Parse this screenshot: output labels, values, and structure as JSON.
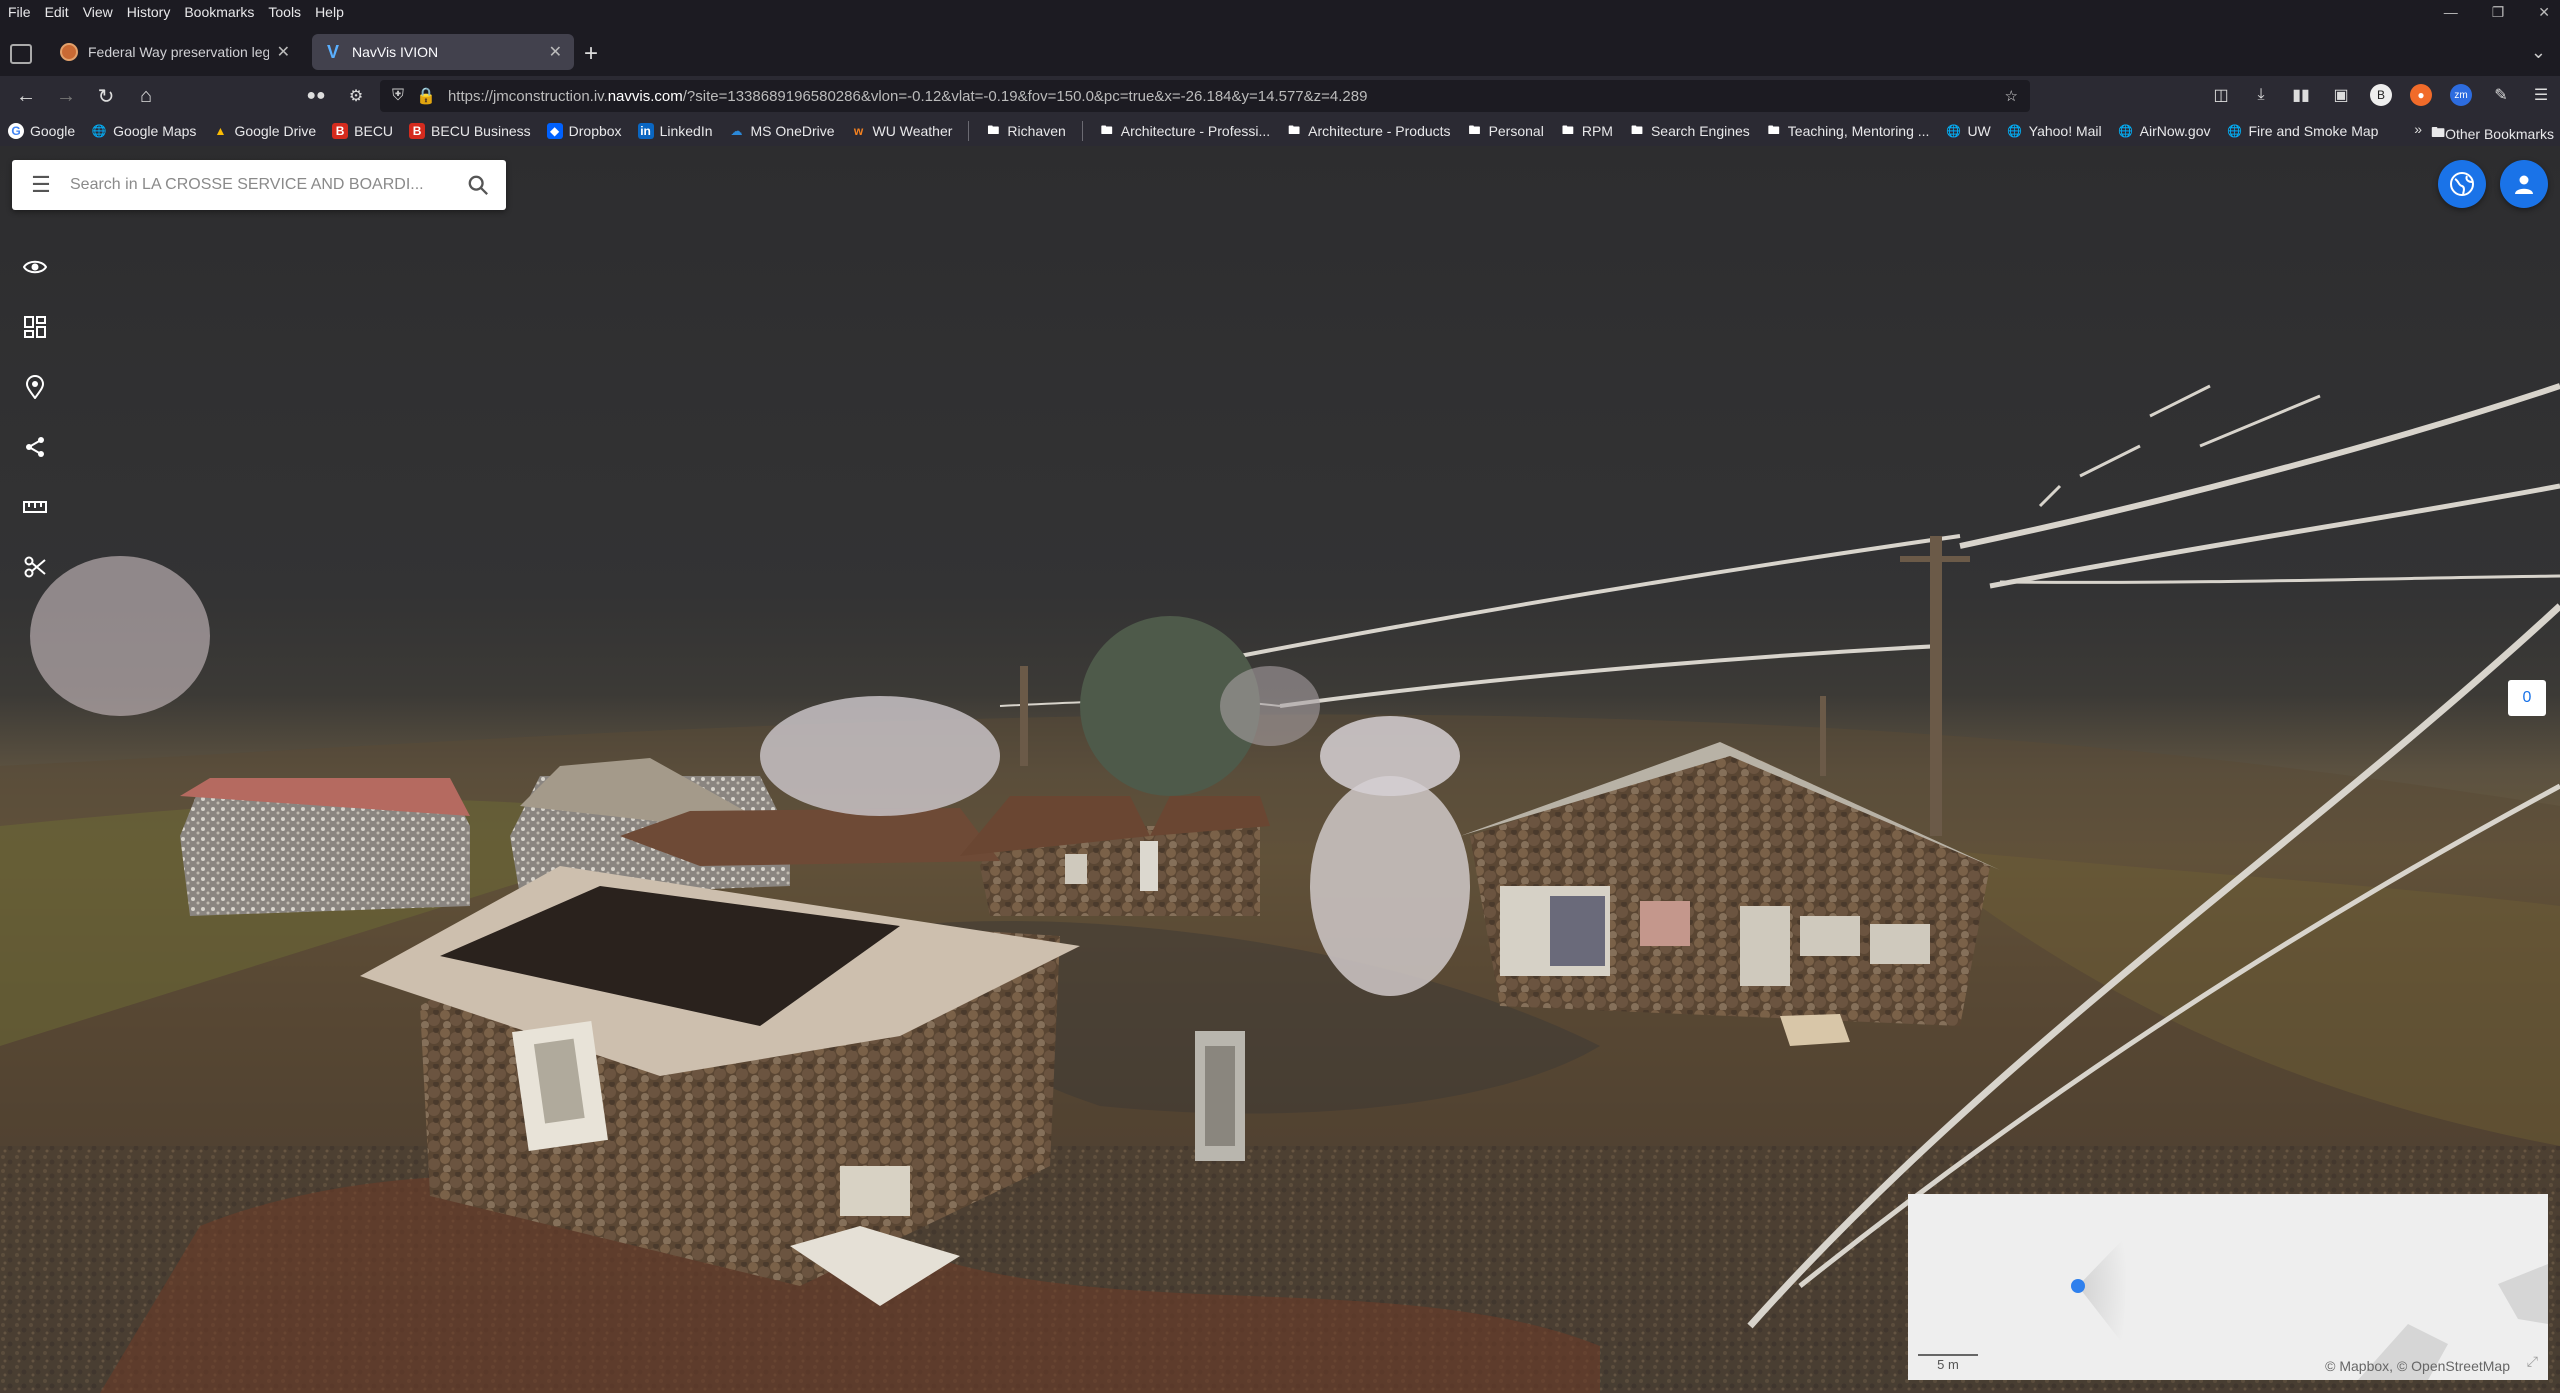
{
  "menubar": {
    "items": [
      "File",
      "Edit",
      "View",
      "History",
      "Bookmarks",
      "Tools",
      "Help"
    ]
  },
  "tabs": [
    {
      "title": "Federal Way preservation legisl",
      "active": false
    },
    {
      "title": "NavVis IVION",
      "active": true
    }
  ],
  "navbar": {
    "url_prefix": "https://jmconstruction.iv.",
    "url_host": "navvis.com",
    "url_rest": "/?site=1338689196580286&vlon=-0.12&vlat=-0.19&fov=150.0&pc=true&x=-26.184&y=14.577&z=4.289"
  },
  "bookmarks": [
    {
      "label": "Google",
      "icon": "globe-icon"
    },
    {
      "label": "Google Maps",
      "icon": "globe-icon"
    },
    {
      "label": "Google Drive",
      "icon": "drive-icon"
    },
    {
      "label": "BECU",
      "icon": "becu-icon"
    },
    {
      "label": "BECU Business",
      "icon": "becu-icon"
    },
    {
      "label": "Dropbox",
      "icon": "dropbox-icon"
    },
    {
      "label": "LinkedIn",
      "icon": "linkedin-icon"
    },
    {
      "label": "MS OneDrive",
      "icon": "onedrive-icon"
    },
    {
      "label": "WU Weather",
      "icon": "weather-icon"
    },
    {
      "label": "Richaven",
      "icon": "folder-icon"
    },
    {
      "label": "Architecture - Professi...",
      "icon": "folder-icon"
    },
    {
      "label": "Architecture - Products",
      "icon": "folder-icon"
    },
    {
      "label": "Personal",
      "icon": "folder-icon"
    },
    {
      "label": "RPM",
      "icon": "folder-icon"
    },
    {
      "label": "Search Engines",
      "icon": "folder-icon"
    },
    {
      "label": "Teaching, Mentoring ...",
      "icon": "folder-icon"
    },
    {
      "label": "UW",
      "icon": "globe-icon"
    },
    {
      "label": "Yahoo! Mail",
      "icon": "globe-icon"
    },
    {
      "label": "AirNow.gov",
      "icon": "globe-icon"
    },
    {
      "label": "Fire and Smoke Map",
      "icon": "globe-icon"
    }
  ],
  "bookmarks_other": "Other Bookmarks",
  "viewer": {
    "search_placeholder": "Search in LA CROSSE SERVICE AND BOARDI...",
    "counter": "0",
    "minimap": {
      "scale": "5 m",
      "attribution": "© Mapbox, © OpenStreetMap"
    }
  },
  "colors": {
    "accent": "#1a73e8",
    "browser_bg": "#1c1b22",
    "toolbar_bg": "#2b2a33",
    "active_tab": "#42414d"
  }
}
